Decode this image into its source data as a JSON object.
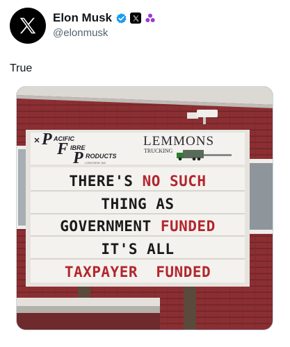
{
  "post": {
    "author": {
      "display_name": "Elon Musk",
      "handle": "@elonmusk",
      "avatar_icon": "x-logo-icon",
      "badges": [
        "verified-badge-icon",
        "x-affiliate-icon",
        "government-badge-icon"
      ],
      "verified_color": "#1d9bf0",
      "gov_badge_color": "#9a3bd6"
    },
    "text": "True",
    "image": {
      "sign": {
        "logo_left": {
          "line1": "ACIFIC",
          "line2": "IBRE",
          "line3": "RODUCTS",
          "line4": "LONGVIEW, WA"
        },
        "logo_right": {
          "name": "LEMMONS",
          "sub": "TRUCKING"
        },
        "lines": [
          {
            "parts": [
              {
                "text": "THERE'S ",
                "color": "#1a1a1a"
              },
              {
                "text": "NO SUCH",
                "color": "#b3262e"
              }
            ]
          },
          {
            "parts": [
              {
                "text": "THING AS",
                "color": "#1a1a1a"
              }
            ]
          },
          {
            "parts": [
              {
                "text": "GOVERNMENT ",
                "color": "#1a1a1a"
              },
              {
                "text": "FUNDED",
                "color": "#b3262e"
              }
            ]
          },
          {
            "parts": [
              {
                "text": "IT'S ALL",
                "color": "#1a1a1a"
              }
            ]
          },
          {
            "parts": [
              {
                "text": "TAXPAYER  FUNDED",
                "color": "#b3262e"
              }
            ]
          }
        ]
      },
      "colors": {
        "barn_red": "#8b2f33",
        "roof": "#d9d6d3",
        "sign_white": "#f4f2ee",
        "frame": "#e6e3de"
      }
    }
  }
}
